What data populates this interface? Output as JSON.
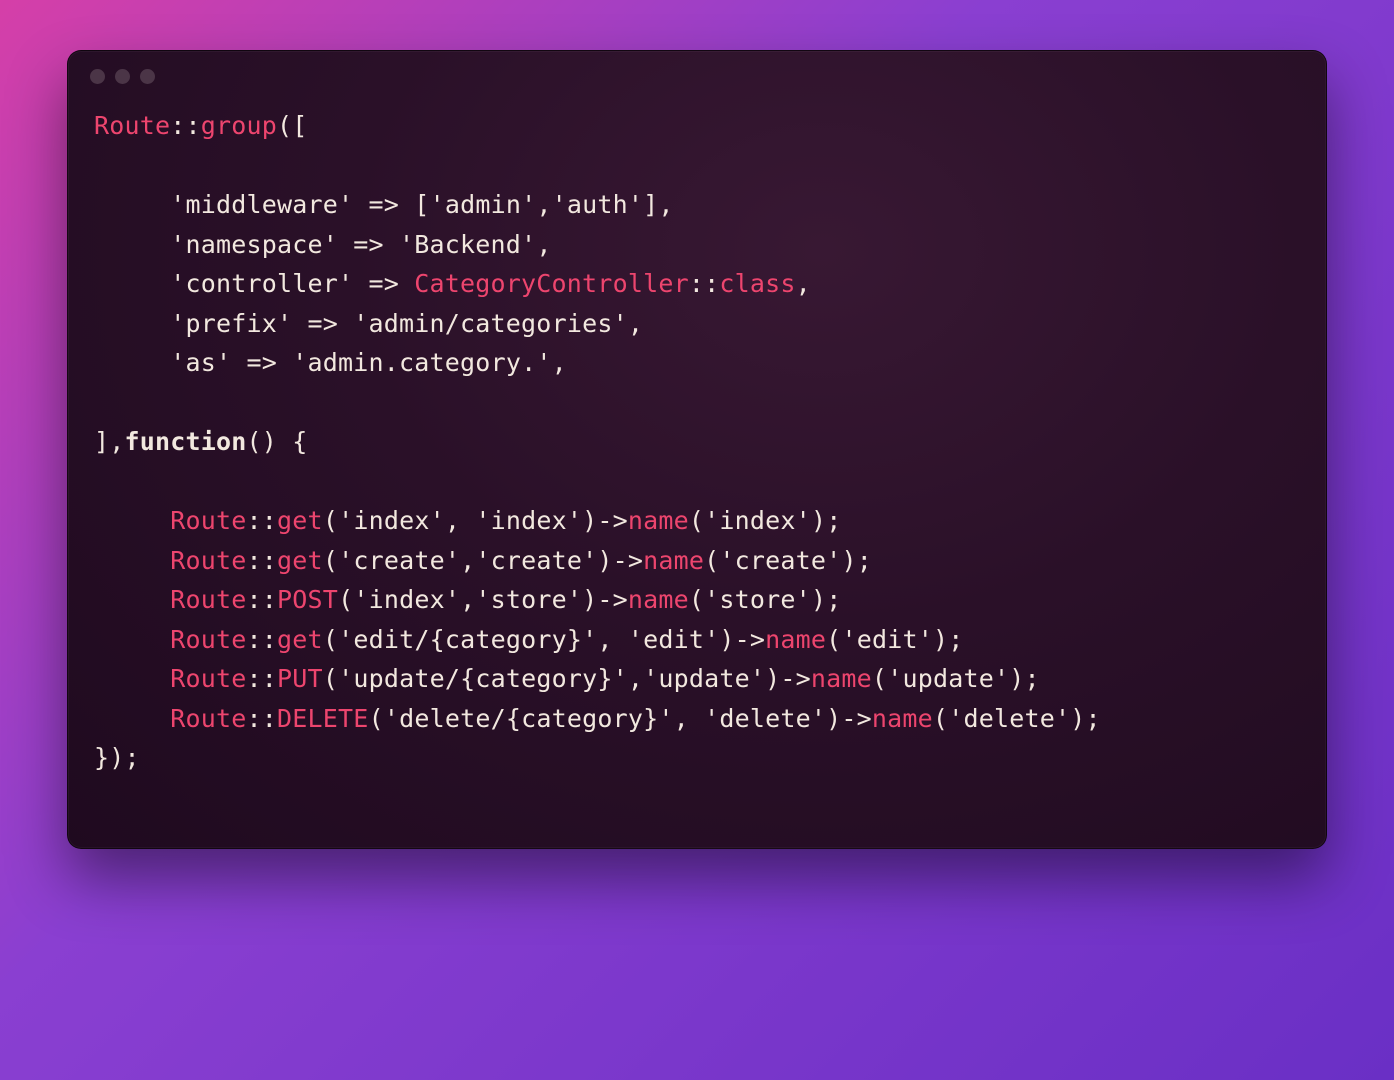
{
  "colors": {
    "accent": "#ed456e",
    "text": "#f2e8df",
    "window_bg_stop1": "#381833",
    "window_bg_stop2": "#2a1028",
    "window_bg_stop3": "#1f0a1f",
    "page_gradient_start": "#d53fa8",
    "page_gradient_end": "#6a2fc5",
    "traffic_light": "#4b3547"
  },
  "code": {
    "l1_class": "Route",
    "l1_sep": "::",
    "l1_fn": "group",
    "l1_punct": "([",
    "l3_key": "'middleware'",
    "l3_arrow": " => ",
    "l3_br_open": "[",
    "l3_val1": "'admin'",
    "l3_comma": ",",
    "l3_val2": "'auth'",
    "l3_br_close": "],",
    "l4_key": "'namespace'",
    "l4_arrow": " => ",
    "l4_val": "'Backend'",
    "l4_end": ",",
    "l5_key": "'controller'",
    "l5_arrow": " => ",
    "l5_ctrl": "CategoryController",
    "l5_sep": "::",
    "l5_class": "class",
    "l5_end": ",",
    "l6_key": "'prefix'",
    "l6_arrow": " => ",
    "l6_val": "'admin/categories'",
    "l6_end": ",",
    "l7_key": "'as'",
    "l7_arrow": " => ",
    "l7_val": "'admin.category.'",
    "l7_end": ",",
    "l9": "],",
    "l9_fn": "function",
    "l9_paren": "() {",
    "r1_class": "Route",
    "r1_sep": "::",
    "r1_method": "get",
    "r1_args_open": "(",
    "r1_arg1": "'index'",
    "r1_mid": ", ",
    "r1_arg2": "'index'",
    "r1_args_close": ")->",
    "r1_name_fn": "name",
    "r1_name_open": "(",
    "r1_name_arg": "'index'",
    "r1_name_close": ");",
    "r2_class": "Route",
    "r2_sep": "::",
    "r2_method": "get",
    "r2_args_open": "(",
    "r2_arg1": "'create'",
    "r2_mid": ",",
    "r2_arg2": "'create'",
    "r2_args_close": ")->",
    "r2_name_fn": "name",
    "r2_name_open": "(",
    "r2_name_arg": "'create'",
    "r2_name_close": ");",
    "r3_class": "Route",
    "r3_sep": "::",
    "r3_method": "POST",
    "r3_args_open": "(",
    "r3_arg1": "'index'",
    "r3_mid": ",",
    "r3_arg2": "'store'",
    "r3_args_close": ")->",
    "r3_name_fn": "name",
    "r3_name_open": "(",
    "r3_name_arg": "'store'",
    "r3_name_close": ");",
    "r4_class": "Route",
    "r4_sep": "::",
    "r4_method": "get",
    "r4_args_open": "(",
    "r4_arg1": "'edit/{category}'",
    "r4_mid": ", ",
    "r4_arg2": "'edit'",
    "r4_args_close": ")->",
    "r4_name_fn": "name",
    "r4_name_open": "(",
    "r4_name_arg": "'edit'",
    "r4_name_close": ");",
    "r5_class": "Route",
    "r5_sep": "::",
    "r5_method": "PUT",
    "r5_args_open": "(",
    "r5_arg1": "'update/{category}'",
    "r5_mid": ",",
    "r5_arg2": "'update'",
    "r5_args_close": ")->",
    "r5_name_fn": "name",
    "r5_name_open": "(",
    "r5_name_arg": "'update'",
    "r5_name_close": ");",
    "r6_class": "Route",
    "r6_sep": "::",
    "r6_method": "DELETE",
    "r6_args_open": "(",
    "r6_arg1": "'delete/{category}'",
    "r6_mid": ", ",
    "r6_arg2": "'delete'",
    "r6_args_close": ")->",
    "r6_name_fn": "name",
    "r6_name_open": "(",
    "r6_name_arg": "'delete'",
    "r6_name_close": ");",
    "lend": "});"
  }
}
